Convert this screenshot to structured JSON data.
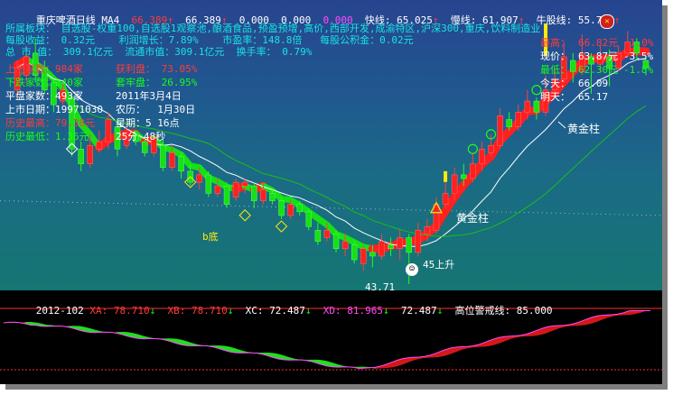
{
  "header": {
    "stock_name": "重庆啤酒",
    "period": "日线",
    "indicator": "MA4",
    "ma4_value": "66.389",
    "ma_value2": "66.389",
    "v3": "0.000",
    "v4": "0.000",
    "v5": "0.000",
    "fast_label": "快线:",
    "fast_value": "65.025",
    "slow_label": "慢线:",
    "slow_value": "61.907",
    "bull_label": "牛股线:",
    "bull_value": "55.774"
  },
  "info": {
    "sector_line": "所属板块： 自选股-权重100,自选股1观察池,酿酒食品,预盈预增,高价,西部开发,成渝特区,沪深300,重庆,饮料制造业",
    "eps_line": "每股收益： 0.32元    利润增长：7.89%    市盈率：148.8倍   每股公积金：0.02元",
    "mcap_line": "总 市 值： 309.1亿元  流通市值：309.1亿元  换手率： 0.79%",
    "up_days": "上涨家数：984家",
    "down_days": "下跌家数：140家",
    "flat_days": "平盘家数：493家",
    "profit_pan": "获利盘： 73.05%",
    "trap_pan": "套牢盘： 26.95%",
    "date_line": "2011年3月4日",
    "list_date": "上市日期：19971030",
    "lunar": "农历：  1月30日",
    "hist_high": "历史最高：79.38元",
    "hist_low": "历史最低：1.36元",
    "weekday": "星期：5 16点",
    "time_left": "25分 48秒"
  },
  "quote": {
    "high_label": "最高：",
    "high_value": "66.82元",
    "high_pct": "1.0%",
    "price_label": "现价：",
    "price_value": "63.87元",
    "price_pct": "-3.5%",
    "low_label": "最低：",
    "low_value": "62.30元",
    "low_pct": "-1.8%",
    "today_label": "今天：",
    "today_value": "66.09",
    "tomorrow_label": "明天：",
    "tomorrow_value": "65.17"
  },
  "annotations": {
    "golden_pillar_1": "黄金柱",
    "golden_pillar_2": "黄金柱",
    "bottom": "b底",
    "low_price": "43.71",
    "rise": "45上升"
  },
  "osc_header": {
    "period_tag": "2012-102",
    "xa_label": "XA:",
    "xa_value": "78.710",
    "xb_label": "XB:",
    "xb_value": "78.710",
    "xc_label": "XC:",
    "xc_value": "72.487",
    "xd_label": "XD:",
    "xd_value": "81.965",
    "v_value": "72.487",
    "alert_label": "高位警戒线:",
    "alert_value": "85.000"
  },
  "colors": {
    "up": "#ff2020",
    "down": "#16e016",
    "ma_white": "#ffffff",
    "bull_green": "#16c016",
    "header_red": "#ff3b3b",
    "yellow": "#ffeb0a",
    "cyan": "#17e3e3"
  },
  "chart_data": {
    "type": "candlestick",
    "ylim": [
      43.71,
      79.38
    ],
    "candles": [
      {
        "o": 70.0,
        "c": 73.0,
        "h": 74.0,
        "l": 69.0
      },
      {
        "o": 72.0,
        "c": 74.5,
        "h": 76.0,
        "l": 71.0
      },
      {
        "o": 75.0,
        "c": 72.0,
        "h": 77.0,
        "l": 71.0
      },
      {
        "o": 73.0,
        "c": 70.0,
        "h": 74.0,
        "l": 69.5
      },
      {
        "o": 71.0,
        "c": 68.0,
        "h": 71.5,
        "l": 67.0
      },
      {
        "o": 68.5,
        "c": 70.0,
        "h": 71.0,
        "l": 68.0
      },
      {
        "o": 69.0,
        "c": 62.0,
        "h": 69.5,
        "l": 61.0
      },
      {
        "o": 62.0,
        "c": 60.0,
        "h": 63.0,
        "l": 59.0
      },
      {
        "o": 60.0,
        "c": 62.5,
        "h": 64.0,
        "l": 59.5
      },
      {
        "o": 62.0,
        "c": 63.0,
        "h": 64.5,
        "l": 61.5
      },
      {
        "o": 63.0,
        "c": 66.0,
        "h": 67.0,
        "l": 62.0
      },
      {
        "o": 65.0,
        "c": 62.0,
        "h": 66.0,
        "l": 61.0
      },
      {
        "o": 62.5,
        "c": 64.0,
        "h": 65.0,
        "l": 62.0
      },
      {
        "o": 64.0,
        "c": 63.0,
        "h": 64.5,
        "l": 62.5
      },
      {
        "o": 63.0,
        "c": 61.5,
        "h": 63.5,
        "l": 61.0
      },
      {
        "o": 61.5,
        "c": 63.5,
        "h": 64.0,
        "l": 61.0
      },
      {
        "o": 62.5,
        "c": 59.5,
        "h": 63.5,
        "l": 59.0
      },
      {
        "o": 59.5,
        "c": 61.5,
        "h": 62.5,
        "l": 59.0
      },
      {
        "o": 61.0,
        "c": 59.0,
        "h": 61.5,
        "l": 58.0
      },
      {
        "o": 59.0,
        "c": 57.5,
        "h": 60.0,
        "l": 57.0
      },
      {
        "o": 57.5,
        "c": 58.5,
        "h": 59.5,
        "l": 56.5
      },
      {
        "o": 58.5,
        "c": 56.0,
        "h": 59.0,
        "l": 55.5
      },
      {
        "o": 56.0,
        "c": 57.0,
        "h": 58.0,
        "l": 55.5
      },
      {
        "o": 57.0,
        "c": 54.5,
        "h": 57.5,
        "l": 54.0
      },
      {
        "o": 55.5,
        "c": 57.5,
        "h": 58.0,
        "l": 55.0
      },
      {
        "o": 57.0,
        "c": 57.5,
        "h": 58.0,
        "l": 56.0
      },
      {
        "o": 57.0,
        "c": 55.0,
        "h": 57.5,
        "l": 54.0
      },
      {
        "o": 55.0,
        "c": 56.5,
        "h": 57.5,
        "l": 54.5
      },
      {
        "o": 56.0,
        "c": 55.0,
        "h": 56.5,
        "l": 54.5
      },
      {
        "o": 55.0,
        "c": 53.0,
        "h": 55.5,
        "l": 52.5
      },
      {
        "o": 53.0,
        "c": 54.5,
        "h": 55.0,
        "l": 52.5
      },
      {
        "o": 54.5,
        "c": 53.5,
        "h": 55.0,
        "l": 53.0
      },
      {
        "o": 53.5,
        "c": 51.5,
        "h": 54.0,
        "l": 51.0
      },
      {
        "o": 51.0,
        "c": 49.5,
        "h": 52.0,
        "l": 49.0
      },
      {
        "o": 50.0,
        "c": 51.0,
        "h": 52.0,
        "l": 49.5
      },
      {
        "o": 50.5,
        "c": 48.5,
        "h": 51.0,
        "l": 48.0
      },
      {
        "o": 48.5,
        "c": 49.5,
        "h": 50.5,
        "l": 47.5
      },
      {
        "o": 49.0,
        "c": 47.0,
        "h": 49.5,
        "l": 46.5
      },
      {
        "o": 46.5,
        "c": 48.5,
        "h": 49.0,
        "l": 45.5
      },
      {
        "o": 48.0,
        "c": 47.5,
        "h": 49.0,
        "l": 46.0
      },
      {
        "o": 47.5,
        "c": 49.5,
        "h": 50.5,
        "l": 47.0
      },
      {
        "o": 49.0,
        "c": 48.5,
        "h": 50.0,
        "l": 47.5
      },
      {
        "o": 48.5,
        "c": 50.0,
        "h": 51.0,
        "l": 47.0
      },
      {
        "o": 50.0,
        "c": 48.0,
        "h": 50.5,
        "l": 43.71
      },
      {
        "o": 48.0,
        "c": 51.0,
        "h": 52.0,
        "l": 47.5
      },
      {
        "o": 50.5,
        "c": 51.5,
        "h": 52.5,
        "l": 49.5
      },
      {
        "o": 51.0,
        "c": 54.5,
        "h": 55.5,
        "l": 50.5
      },
      {
        "o": 54.5,
        "c": 56.0,
        "h": 58.0,
        "l": 54.0
      },
      {
        "o": 56.0,
        "c": 58.5,
        "h": 59.5,
        "l": 55.0
      },
      {
        "o": 58.5,
        "c": 58.0,
        "h": 60.0,
        "l": 57.0
      },
      {
        "o": 58.0,
        "c": 60.0,
        "h": 61.5,
        "l": 57.5
      },
      {
        "o": 60.0,
        "c": 62.0,
        "h": 63.0,
        "l": 59.0
      },
      {
        "o": 61.5,
        "c": 62.5,
        "h": 64.0,
        "l": 61.0
      },
      {
        "o": 62.5,
        "c": 66.5,
        "h": 67.5,
        "l": 62.0
      },
      {
        "o": 66.0,
        "c": 65.0,
        "h": 67.0,
        "l": 64.5
      },
      {
        "o": 65.0,
        "c": 67.0,
        "h": 68.0,
        "l": 64.5
      },
      {
        "o": 67.0,
        "c": 68.5,
        "h": 70.0,
        "l": 66.0
      },
      {
        "o": 68.5,
        "c": 67.0,
        "h": 69.0,
        "l": 66.0
      },
      {
        "o": 67.0,
        "c": 70.0,
        "h": 72.0,
        "l": 66.5
      },
      {
        "o": 70.0,
        "c": 71.5,
        "h": 73.0,
        "l": 69.0
      },
      {
        "o": 71.5,
        "c": 74.5,
        "h": 76.5,
        "l": 71.0
      },
      {
        "o": 74.0,
        "c": 72.5,
        "h": 75.0,
        "l": 71.0
      },
      {
        "o": 72.5,
        "c": 75.0,
        "h": 77.5,
        "l": 72.0
      },
      {
        "o": 74.5,
        "c": 73.5,
        "h": 75.0,
        "l": 69.5
      },
      {
        "o": 73.5,
        "c": 74.5,
        "h": 76.0,
        "l": 72.5
      },
      {
        "o": 74.5,
        "c": 73.0,
        "h": 75.5,
        "l": 70.5
      },
      {
        "o": 73.0,
        "c": 75.0,
        "h": 76.0,
        "l": 72.5
      },
      {
        "o": 75.0,
        "c": 76.5,
        "h": 78.0,
        "l": 74.5
      },
      {
        "o": 76.5,
        "c": 75.0,
        "h": 77.0,
        "l": 74.0
      },
      {
        "o": 74.0,
        "c": 73.0,
        "h": 74.5,
        "l": 72.0
      }
    ]
  }
}
